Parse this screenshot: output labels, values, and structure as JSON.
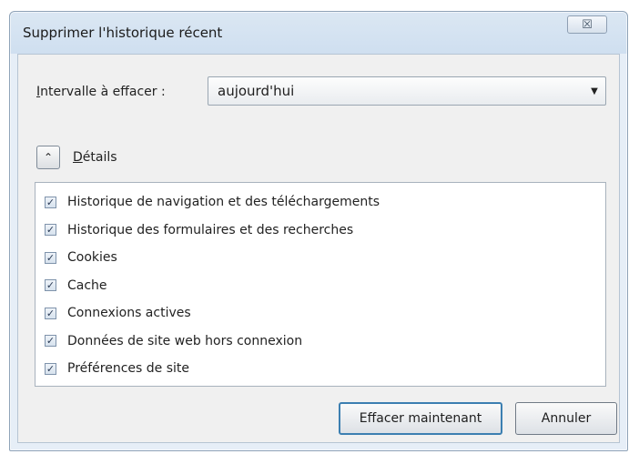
{
  "window": {
    "title": "Supprimer l'historique récent",
    "close_glyph": "☒"
  },
  "interval": {
    "label_accel": "I",
    "label_rest": "ntervalle à effacer :",
    "selected": "aujourd'hui",
    "arrow_glyph": "▼"
  },
  "details": {
    "toggle_glyph": "⌃",
    "label_accel": "D",
    "label_rest": "étails"
  },
  "items": [
    {
      "label": "Historique de navigation et des téléchargements",
      "checked": true
    },
    {
      "label": "Historique des formulaires et des recherches",
      "checked": true
    },
    {
      "label": "Cookies",
      "checked": true
    },
    {
      "label": "Cache",
      "checked": true
    },
    {
      "label": "Connexions actives",
      "checked": true
    },
    {
      "label": "Données de site web hors connexion",
      "checked": true
    },
    {
      "label": "Préférences de site",
      "checked": true
    }
  ],
  "check_glyph": "✓",
  "buttons": {
    "clear_now": "Effacer maintenant",
    "cancel": "Annuler"
  }
}
